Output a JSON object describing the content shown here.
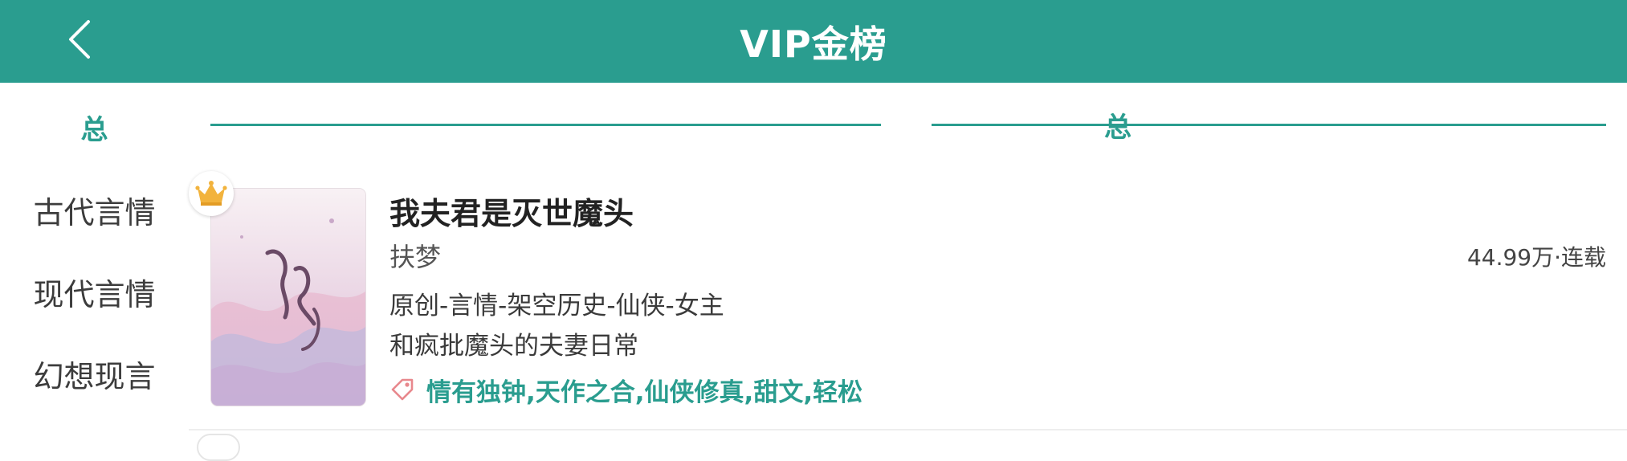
{
  "header": {
    "title": "VIP金榜"
  },
  "sidebar": {
    "items": [
      {
        "label": "总",
        "active": true
      },
      {
        "label": "古代言情",
        "active": false
      },
      {
        "label": "现代言情",
        "active": false
      },
      {
        "label": "幻想现言",
        "active": false
      }
    ]
  },
  "section": {
    "label": "总"
  },
  "books": [
    {
      "title": "我夫君是灭世魔头",
      "author": "扶梦",
      "category": "原创-言情-架空历史-仙侠-女主",
      "description": "和疯批魔头的夫妻日常",
      "tags": "情有独钟,天作之合,仙侠修真,甜文,轻松",
      "meta": "44.99万·连载"
    }
  ],
  "colors": {
    "accent": "#2a9d8f",
    "crown": "#f2b33d"
  },
  "icons": {
    "back": "chevron-left-icon",
    "rank": "crown-icon",
    "tag": "tag-icon"
  }
}
